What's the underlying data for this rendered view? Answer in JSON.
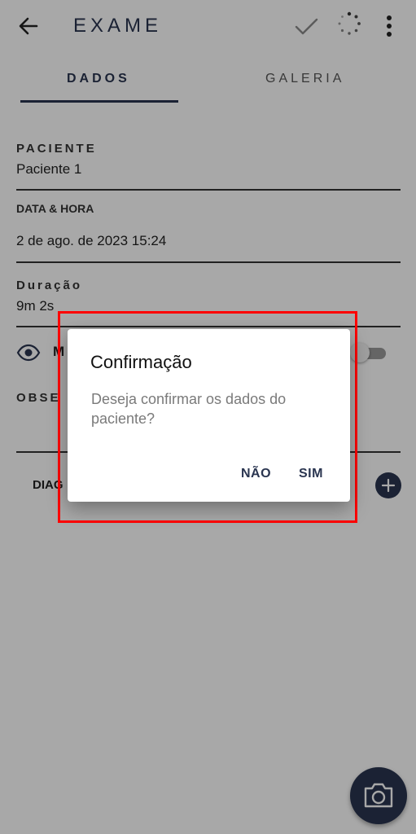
{
  "header": {
    "title": "EXAME",
    "back_icon": "arrow-left-icon",
    "confirm_icon": "check-icon",
    "sync_icon": "loading-icon",
    "menu_icon": "more-vertical-icon"
  },
  "tabs": [
    {
      "label": "DADOS",
      "active": true
    },
    {
      "label": "GALERIA",
      "active": false
    }
  ],
  "form": {
    "paciente_label": "PACIENTE",
    "paciente_value": "Paciente 1",
    "data_label": "DATA & HORA",
    "data_value": "2 de ago. de 2023 15:24",
    "duracao_label": "Duração",
    "duracao_value": "9m 2s",
    "visibility_label_partial": "M",
    "visibility_toggle_on": false,
    "obs_label_partial": "OBSE",
    "diag_label_partial": "DIAG"
  },
  "dialog": {
    "title": "Confirmação",
    "message": "Deseja confirmar os dados do paciente?",
    "cancel_label": "NÃO",
    "confirm_label": "SIM"
  },
  "colors": {
    "primary": "#2a3550",
    "highlight": "#ff0000",
    "scrim": "rgba(0,0,0,0.34)"
  }
}
